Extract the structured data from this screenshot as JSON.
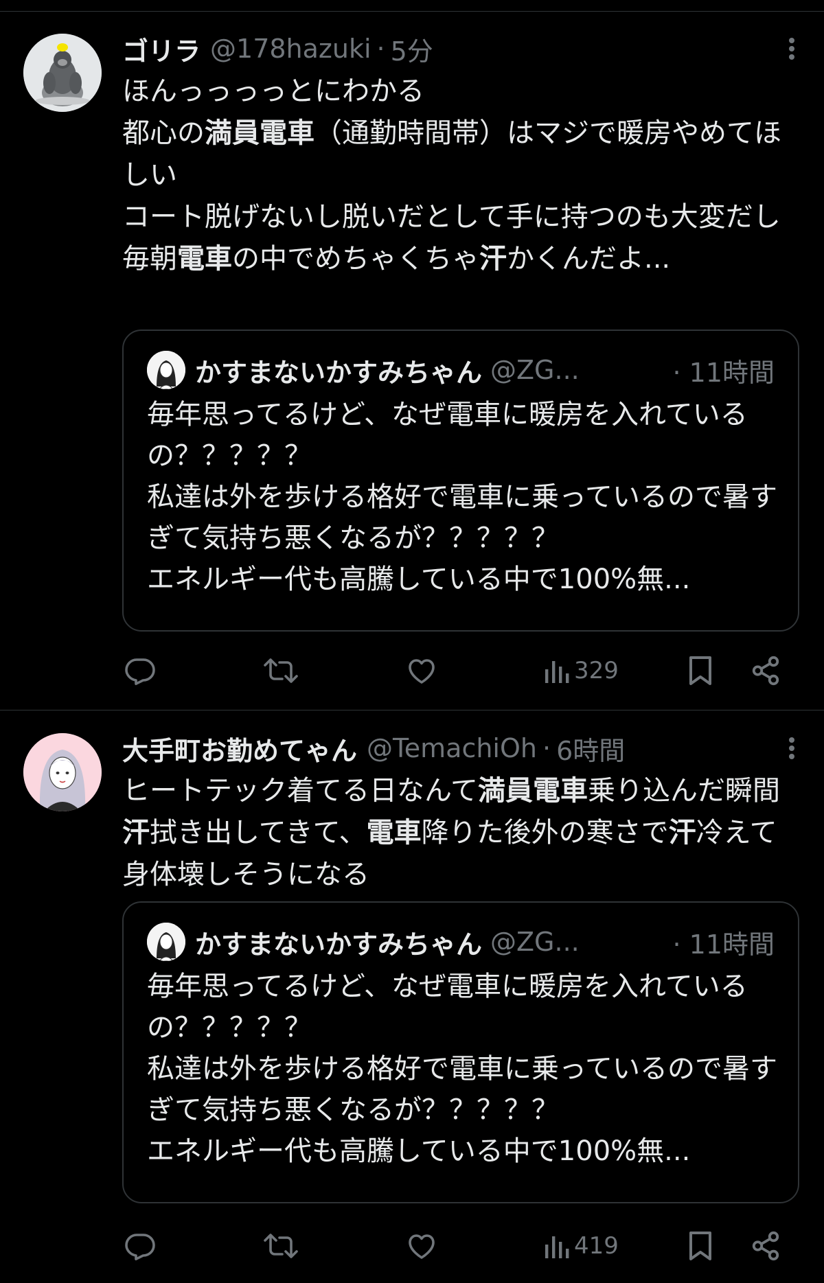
{
  "tweets": [
    {
      "display_name": "ゴリラ",
      "handle": "@178hazuki",
      "sep": "·",
      "time": "5分",
      "avatar_icon": "gorilla-avatar",
      "body_segments": [
        {
          "text": "ほんっっっっとにわかる\n都心の",
          "bold": false
        },
        {
          "text": "満員電車",
          "bold": true
        },
        {
          "text": "（通勤時間帯）はマジで暖房やめてほしい\nコート脱げないし脱いだとして手に持つのも大変だし\n毎朝",
          "bold": false
        },
        {
          "text": "電車",
          "bold": true
        },
        {
          "text": "の中でめちゃくちゃ",
          "bold": false
        },
        {
          "text": "汗",
          "bold": true
        },
        {
          "text": "かくんだよ...",
          "bold": false
        }
      ],
      "quote": {
        "display_name": "かすまないかすみちゃん",
        "handle": "@ZG...",
        "time": "· 11時間",
        "body": "毎年思ってるけど、なぜ電車に暖房を入れているの？？？？？\n私達は外を歩ける格好で電車に乗っているので暑すぎて気持ち悪くなるが？？？？？\nエネルギー代も高騰している中で100%無..."
      },
      "views": "329"
    },
    {
      "display_name": "大手町お勤めてゃん",
      "handle": "@TemachiOh",
      "sep": "·",
      "time": "6時間",
      "avatar_icon": "girl-avatar",
      "body_segments": [
        {
          "text": "ヒートテック着てる日なんて",
          "bold": false
        },
        {
          "text": "満員電車",
          "bold": true
        },
        {
          "text": "乗り込んだ瞬間",
          "bold": false
        },
        {
          "text": "汗",
          "bold": true
        },
        {
          "text": "拭き出してきて、",
          "bold": false
        },
        {
          "text": "電車",
          "bold": true
        },
        {
          "text": "降りた後外の寒さで",
          "bold": false
        },
        {
          "text": "汗",
          "bold": true
        },
        {
          "text": "冷えて身体壊しそうになる",
          "bold": false
        }
      ],
      "quote": {
        "display_name": "かすまないかすみちゃん",
        "handle": "@ZG...",
        "time": "· 11時間",
        "body": "毎年思ってるけど、なぜ電車に暖房を入れているの？？？？？\n私達は外を歩ける格好で電車に乗っているので暑すぎて気持ち悪くなるが？？？？？\nエネルギー代も高騰している中で100%無..."
      },
      "views": "419"
    }
  ],
  "icons": {
    "reply": "reply-icon",
    "repost": "repost-icon",
    "like": "heart-icon",
    "views": "views-icon",
    "bookmark": "bookmark-icon",
    "share": "share-icon",
    "more": "more-icon"
  },
  "colors": {
    "background": "#000000",
    "text": "#e7e9ea",
    "muted": "#71767b",
    "border": "#2f3336"
  }
}
